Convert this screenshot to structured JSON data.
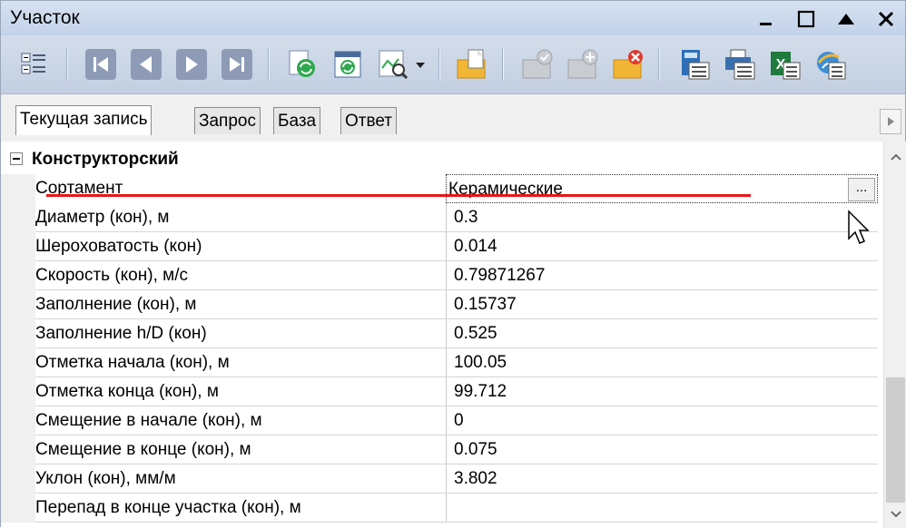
{
  "window": {
    "title": "Участок"
  },
  "toolbar": {
    "buttons": [
      {
        "icon": "property-list-icon"
      },
      {
        "icon": "first-record-icon"
      },
      {
        "icon": "prev-record-icon"
      },
      {
        "icon": "next-record-icon"
      },
      {
        "icon": "last-record-icon"
      },
      {
        "icon": "refresh-data-icon"
      },
      {
        "icon": "sync-icon"
      },
      {
        "icon": "zoom-search-icon"
      },
      {
        "icon": "dropdown-arrow-icon"
      },
      {
        "icon": "new-record-icon"
      },
      {
        "icon": "accept-record-icon"
      },
      {
        "icon": "add-record-icon"
      },
      {
        "icon": "delete-record-icon"
      },
      {
        "icon": "calculator-icon"
      },
      {
        "icon": "print-icon"
      },
      {
        "icon": "excel-export-icon"
      },
      {
        "icon": "web-icon"
      }
    ]
  },
  "tabs": [
    {
      "label": "Текущая запись",
      "active": true
    },
    {
      "label": "Запрос",
      "active": false
    },
    {
      "label": "База",
      "active": false
    },
    {
      "label": "Ответ",
      "active": false
    }
  ],
  "grid": {
    "category": "Конструкторский",
    "rows": [
      {
        "name": "Сортамент",
        "value": "Керамические",
        "selected": true
      },
      {
        "name": "Диаметр (кон), м",
        "value": "0.3"
      },
      {
        "name": "Шероховатость (кон)",
        "value": "0.014"
      },
      {
        "name": "Скорость (кон), м/с",
        "value": "0.79871267"
      },
      {
        "name": "Заполнение (кон), м",
        "value": "0.15737"
      },
      {
        "name": "Заполнение h/D (кон)",
        "value": "0.525"
      },
      {
        "name": "Отметка начала (кон), м",
        "value": "100.05"
      },
      {
        "name": "Отметка конца (кон), м",
        "value": "99.712"
      },
      {
        "name": "Смещение в начале (кон), м",
        "value": "0"
      },
      {
        "name": "Смещение в конце (кон), м",
        "value": "0.075"
      },
      {
        "name": "Уклон (кон), мм/м",
        "value": "3.802"
      },
      {
        "name": "Перепад в конце участка (кон), м",
        "value": ""
      }
    ],
    "ellipsis_label": "..."
  },
  "colors": {
    "accent_red": "#e8161b",
    "title_bar": "#c9d8ec"
  }
}
